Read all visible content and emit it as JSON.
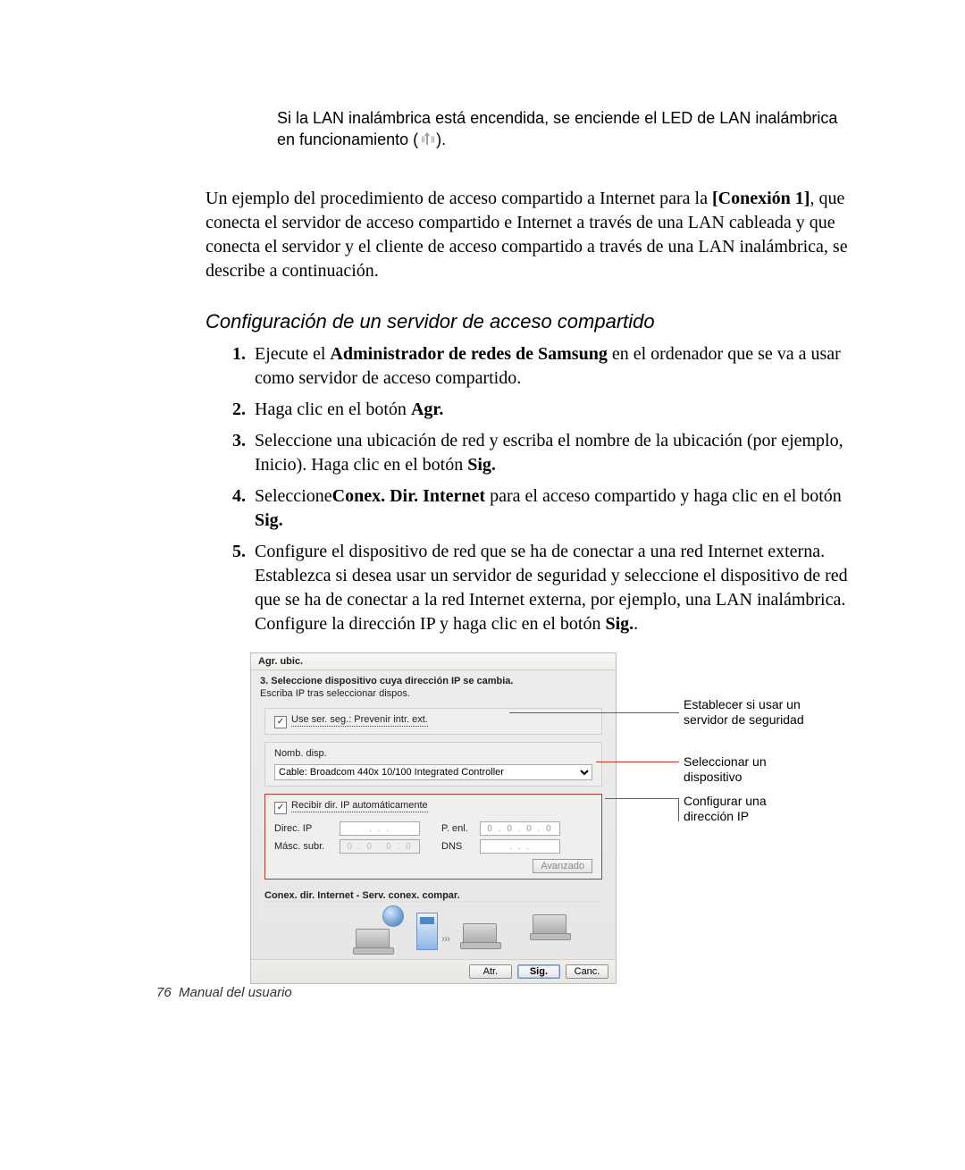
{
  "note": {
    "line1": "Si la LAN inalámbrica está encendida, se enciende el LED de LAN inalámbrica",
    "line2_pre": "en funcionamiento (",
    "line2_post": ")."
  },
  "intro": {
    "t1": "Un ejemplo del procedimiento de acceso compartido a Internet para la ",
    "bold1": "[Conexión 1]",
    "t2": ", que conecta el servidor de acceso compartido e Internet a través de una LAN cableada y que conecta el servidor y el cliente de acceso compartido a través de una LAN inalámbrica, se describe a continuación."
  },
  "section_title": "Configuración de un servidor de acceso compartido",
  "steps": {
    "s1_a": "Ejecute el ",
    "s1_b": "Administrador de redes de Samsung",
    "s1_c": " en el ordenador que se va a usar como servidor de acceso compartido.",
    "s2_a": "Haga clic en el botón ",
    "s2_b": "Agr.",
    "s3_a": "Seleccione una ubicación de red y escriba el nombre de la ubicación (por ejemplo, Inicio). Haga clic en el botón ",
    "s3_b": "Sig.",
    "s4_a": "Seleccione",
    "s4_b": "Conex. Dir. Internet",
    "s4_c": " para el acceso compartido y haga clic en el botón ",
    "s4_d": "Sig.",
    "s5_a": "Configure el dispositivo de red que se ha de conectar a una red Internet externa. Establezca si desea usar un servidor de seguridad y seleccione el dispositivo de red que se ha de conectar a la red Internet externa, por ejemplo, una LAN inalámbrica. Configure la dirección IP y haga clic en el botón  ",
    "s5_b": "Sig.",
    "s5_c": "."
  },
  "dialog": {
    "title": "Agr. ubic.",
    "heading": "3. Seleccione dispositivo cuya dirección IP se cambia.",
    "subheading": "Escriba IP tras seleccionar dispos.",
    "chk_firewall": "Use ser. seg.: Prevenir intr. ext.",
    "device_label": "Nomb. disp.",
    "device_value": "Cable: Broadcom 440x 10/100 Integrated Controller",
    "chk_auto_ip": "Recibir dir. IP automáticamente",
    "lbl_ip": "Direc. IP",
    "lbl_mask": "Másc. subr.",
    "lbl_gw": "P. enl.",
    "lbl_dns": "DNS",
    "ip_placeholder_zeros": "0 . 0 . 0 . 0",
    "ip_placeholder_dots": ".   .   .",
    "btn_advanced": "Avanzado",
    "diagram_title": "Conex. dir. Internet - Serv. conex. compar.",
    "btn_back": "Atr.",
    "btn_next": "Sig.",
    "btn_cancel": "Canc."
  },
  "callouts": {
    "c1": "Establecer si usar un servidor de seguridad",
    "c2": "Seleccionar un dispositivo",
    "c3": "Configurar una dirección IP"
  },
  "footer": {
    "page": "76",
    "label": "Manual del usuario"
  }
}
